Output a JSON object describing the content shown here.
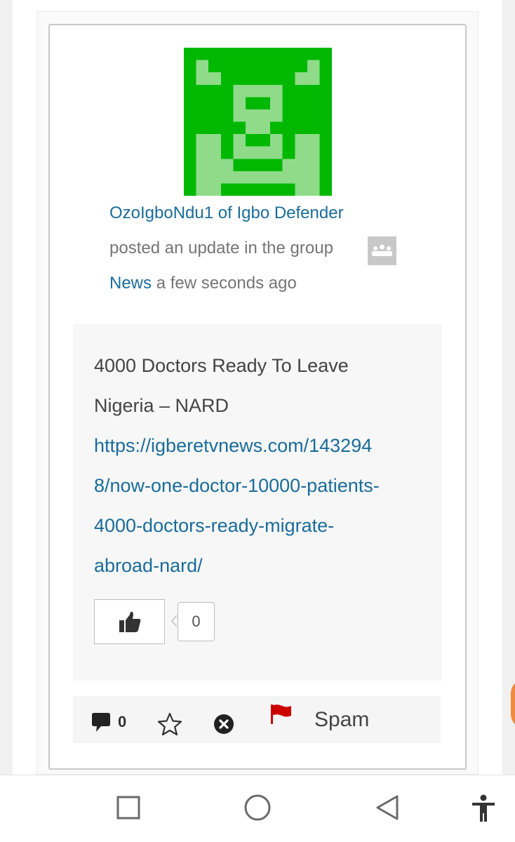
{
  "activity": {
    "author": "OzoIgboNdu1 of Igbo Defender",
    "action_text": "posted an update in the group",
    "group_name": "News",
    "timestamp": "a few seconds ago",
    "content": {
      "title_line1": "4000 Doctors Ready To Leave",
      "title_line2": "Nigeria – NARD",
      "link_line1": "https://igberetvnews.com/143294",
      "link_line2": "8/now-one-doctor-10000-patients-",
      "link_line3": "4000-doctors-ready-migrate-",
      "link_line4": "abroad-nard/"
    },
    "like_count": "0"
  },
  "actions": {
    "comment_count": "0",
    "spam_label": "Spam"
  },
  "icons": {
    "avatar": "identicon-avatar",
    "group": "group-icon",
    "like": "thumbs-up-icon",
    "comment": "comment-icon",
    "favorite": "star-icon",
    "delete": "close-circle-icon",
    "spam": "flag-icon",
    "nav": [
      "square-icon",
      "circle-icon",
      "back-triangle-icon",
      "accessibility-icon"
    ]
  },
  "colors": {
    "link": "#1a6c9a",
    "avatar_dark": "#00b800",
    "avatar_light": "#8fdb8a",
    "flag": "#cc0000"
  }
}
